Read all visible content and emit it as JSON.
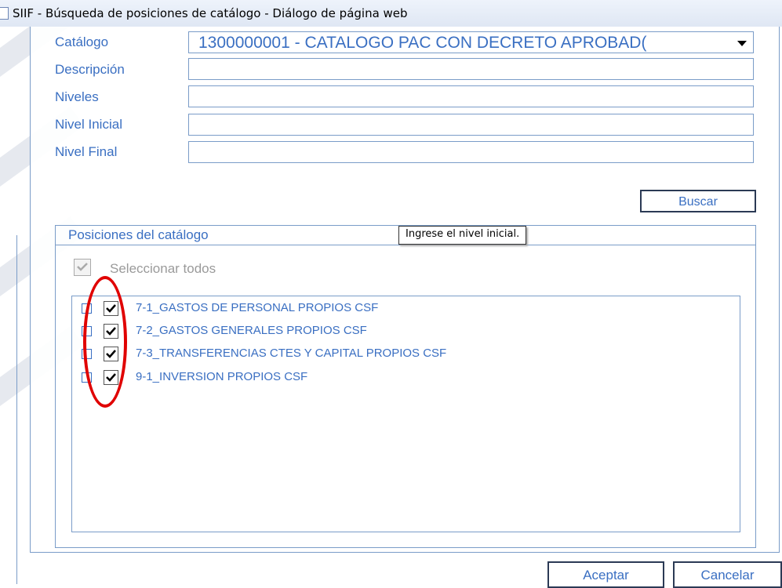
{
  "window": {
    "title": "SIIF - Búsqueda de posiciones de catálogo - Diálogo de página web"
  },
  "form": {
    "catalogo_label": "Catálogo",
    "catalogo_value": "1300000001 - CATALOGO PAC CON DECRETO APROBAD(",
    "descripcion_label": "Descripción",
    "descripcion_value": "",
    "niveles_label": "Niveles",
    "niveles_value": "",
    "nivel_inicial_label": "Nivel Inicial",
    "nivel_inicial_value": "",
    "nivel_final_label": "Nivel Final",
    "nivel_final_value": ""
  },
  "buttons": {
    "buscar": "Buscar",
    "aceptar": "Aceptar",
    "cancelar": "Cancelar"
  },
  "positions": {
    "legend": "Posiciones del catálogo",
    "tooltip": "Ingrese el nivel inicial.",
    "select_all_label": "Seleccionar todos",
    "select_all_checked": true,
    "items": [
      {
        "label": "7-1_GASTOS DE PERSONAL PROPIOS CSF",
        "checked": true
      },
      {
        "label": "7-2_GASTOS GENERALES PROPIOS CSF",
        "checked": true
      },
      {
        "label": "7-3_TRANSFERENCIAS CTES Y CAPITAL PROPIOS CSF",
        "checked": true
      },
      {
        "label": "9-1_INVERSION PROPIOS CSF",
        "checked": true
      }
    ]
  },
  "colors": {
    "label_blue": "#3a6fc2",
    "border_blue": "#7a9cc8",
    "highlight_red": "#e00000"
  }
}
